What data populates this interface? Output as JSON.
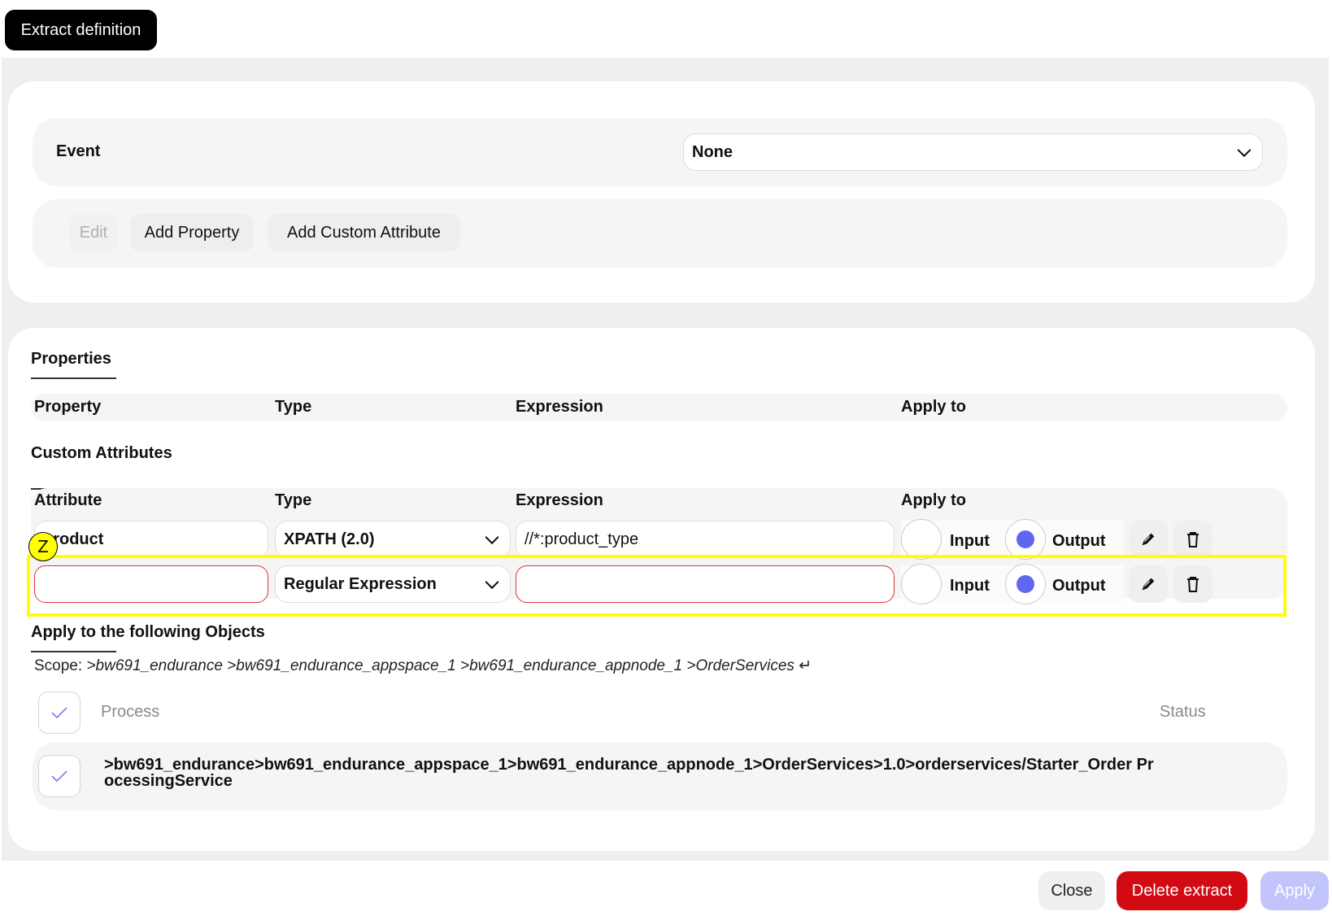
{
  "header": {
    "title": "Extract definition"
  },
  "event": {
    "label": "Event",
    "selected": "None"
  },
  "actions": {
    "edit": "Edit",
    "add_property": "Add Property",
    "add_custom_attribute": "Add Custom Attribute"
  },
  "properties": {
    "title": "Properties",
    "columns": [
      "Property",
      "Type",
      "Expression",
      "Apply to"
    ]
  },
  "custom_attributes": {
    "title": "Custom Attributes",
    "columns": [
      "Attribute",
      "Type",
      "Expression",
      "Apply to"
    ],
    "rows": [
      {
        "attribute": "product",
        "type": "XPATH (2.0)",
        "expression": "//*:product_type",
        "input_label": "Input",
        "output_label": "Output",
        "input_selected": false,
        "output_selected": true
      },
      {
        "attribute": "",
        "type": "Regular Expression",
        "expression": "",
        "input_label": "Input",
        "output_label": "Output",
        "input_selected": false,
        "output_selected": true
      }
    ]
  },
  "annotation": {
    "badge": "Z",
    "color": "#ffff00"
  },
  "objects": {
    "title": "Apply to the following Objects",
    "scope_label": "Scope:",
    "scope_path": ">bw691_endurance >bw691_endurance_appspace_1 >bw691_endurance_appnode_1 >OrderServices",
    "scope_return_icon": "↵",
    "list_header": {
      "process": "Process",
      "status": "Status"
    },
    "items": [
      {
        "path": ">bw691_endurance>bw691_endurance_appspace_1>bw691_endurance_appnode_1>OrderServices>1.0>orderservices/Starter_Order ProcessingService",
        "checked": true
      }
    ]
  },
  "footer": {
    "close": "Close",
    "delete": "Delete extract",
    "apply": "Apply"
  },
  "colors": {
    "accent": "#5f66f1",
    "danger": "#d20a11",
    "apply_disabled": "#c2c5fb",
    "error_border": "#d9363e"
  }
}
